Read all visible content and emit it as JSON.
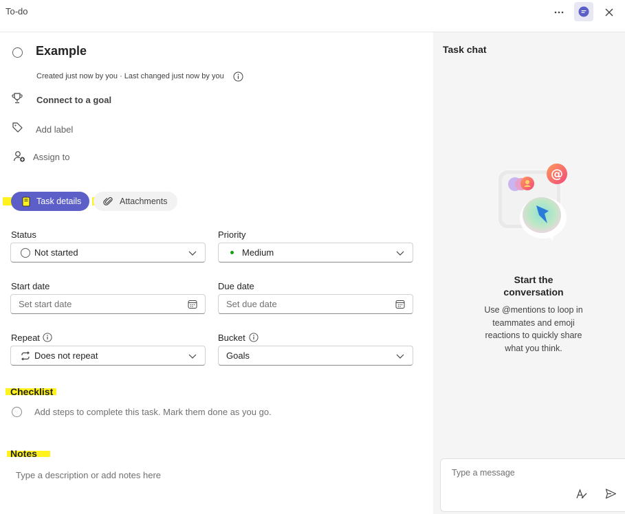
{
  "window": {
    "title": "To-do"
  },
  "task": {
    "title": "Example",
    "meta": "Created just now by you · Last changed just now by you",
    "goal_label": "Connect to a goal",
    "label_placeholder": "Add label",
    "assign_label": "Assign to"
  },
  "tabs": [
    {
      "label": "Task details",
      "active": true
    },
    {
      "label": "Attachments",
      "active": false
    }
  ],
  "fields": {
    "status": {
      "label": "Status",
      "value": "Not started"
    },
    "priority": {
      "label": "Priority",
      "value": "Medium",
      "dot_color": "#13a10e"
    },
    "start_date": {
      "label": "Start date",
      "placeholder": "Set start date"
    },
    "due_date": {
      "label": "Due date",
      "placeholder": "Set due date"
    },
    "repeat": {
      "label": "Repeat",
      "value": "Does not repeat"
    },
    "bucket": {
      "label": "Bucket",
      "value": "Goals"
    }
  },
  "checklist": {
    "title": "Checklist",
    "placeholder": "Add steps to complete this task. Mark them done as you go."
  },
  "notes": {
    "title": "Notes",
    "placeholder": "Type a description or add notes here"
  },
  "chat": {
    "heading": "Task chat",
    "title_line1": "Start the",
    "title_line2": "conversation",
    "description": "Use @mentions to loop in teammates and emoji reactions to quickly share what you think.",
    "message_placeholder": "Type a message"
  },
  "colors": {
    "accent": "#5b5fc7",
    "highlight": "#fff21f",
    "chat_bg": "#f5f5f5"
  },
  "icons": [
    "more-icon",
    "chat-icon",
    "close-icon",
    "trophy-icon",
    "tag-icon",
    "person-add-icon",
    "info-icon",
    "notebook-icon",
    "paperclip-icon",
    "chevron-down-icon",
    "calendar-icon",
    "repeat-icon",
    "format-icon",
    "send-icon"
  ]
}
